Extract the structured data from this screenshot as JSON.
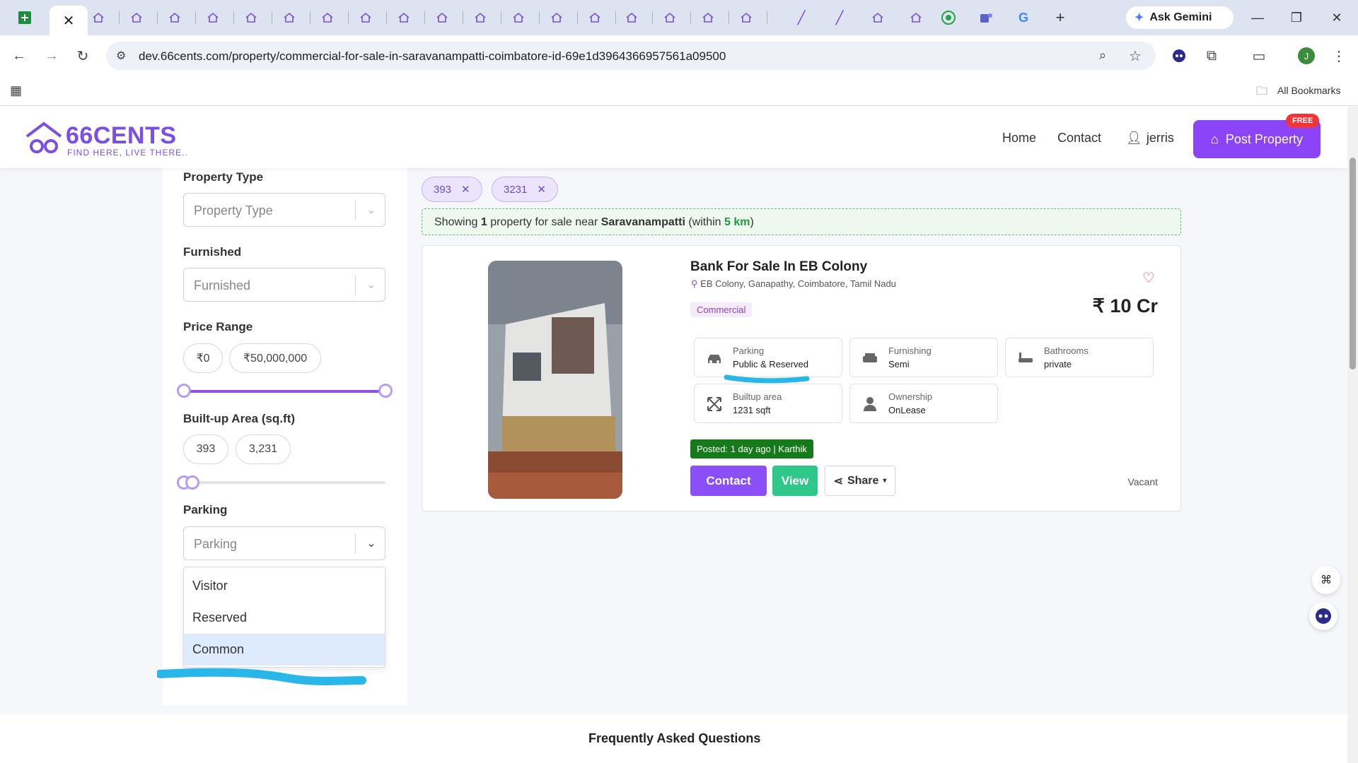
{
  "browser": {
    "url": "dev.66cents.com/property/commercial-for-sale-in-saravanampatti-coimbatore-id-69e1d3964366957561a09500",
    "ask_gemini": "Ask Gemini",
    "all_bookmarks": "All Bookmarks",
    "profile_initial": "J"
  },
  "site": {
    "logo": "66CENTS",
    "tagline": "FIND HERE, LIVE THERE..",
    "nav": {
      "home": "Home",
      "contact": "Contact",
      "user": "jerris"
    },
    "post_property": "Post Property",
    "free_badge": "FREE"
  },
  "filters": {
    "property_type": {
      "label": "Property Type",
      "placeholder": "Property Type"
    },
    "furnished": {
      "label": "Furnished",
      "placeholder": "Furnished"
    },
    "price_range": {
      "label": "Price Range",
      "min": "₹0",
      "max": "₹50,000,000"
    },
    "builtup": {
      "label": "Built-up Area (sq.ft)",
      "min": "393",
      "max": "3,231"
    },
    "parking": {
      "label": "Parking",
      "placeholder": "Parking",
      "options": [
        "Visitor",
        "Reserved",
        "Common"
      ],
      "highlighted": "Common"
    }
  },
  "chips": [
    "393",
    "3231"
  ],
  "results": {
    "prefix": "Showing",
    "count": "1",
    "mid": "property for sale near",
    "location": "Saravanampatti",
    "within_prefix": "(within",
    "distance": "5 km",
    "within_suffix": ")"
  },
  "listing": {
    "title": "Bank For Sale In EB Colony",
    "location": "EB Colony, Ganapathy, Coimbatore, Tamil Nadu",
    "type": "Commercial",
    "price": "₹ 10 Cr",
    "features": {
      "parking": {
        "key": "Parking",
        "value": "Public & Reserved"
      },
      "furnishing": {
        "key": "Furnishing",
        "value": "Semi"
      },
      "bathrooms": {
        "key": "Bathrooms",
        "value": "private"
      },
      "builtup": {
        "key": "Builtup area",
        "value": "1231 sqft"
      },
      "ownership": {
        "key": "Ownership",
        "value": "OnLease"
      }
    },
    "posted": "Posted: 1 day ago | Karthik",
    "contact_btn": "Contact",
    "view_btn": "View",
    "share_btn": "Share",
    "status": "Vacant"
  },
  "faq": {
    "title": "Frequently Asked Questions"
  },
  "colors": {
    "brand": "#8b44f7",
    "accent_green": "#2fc78a",
    "annotation": "#29b6e8"
  }
}
